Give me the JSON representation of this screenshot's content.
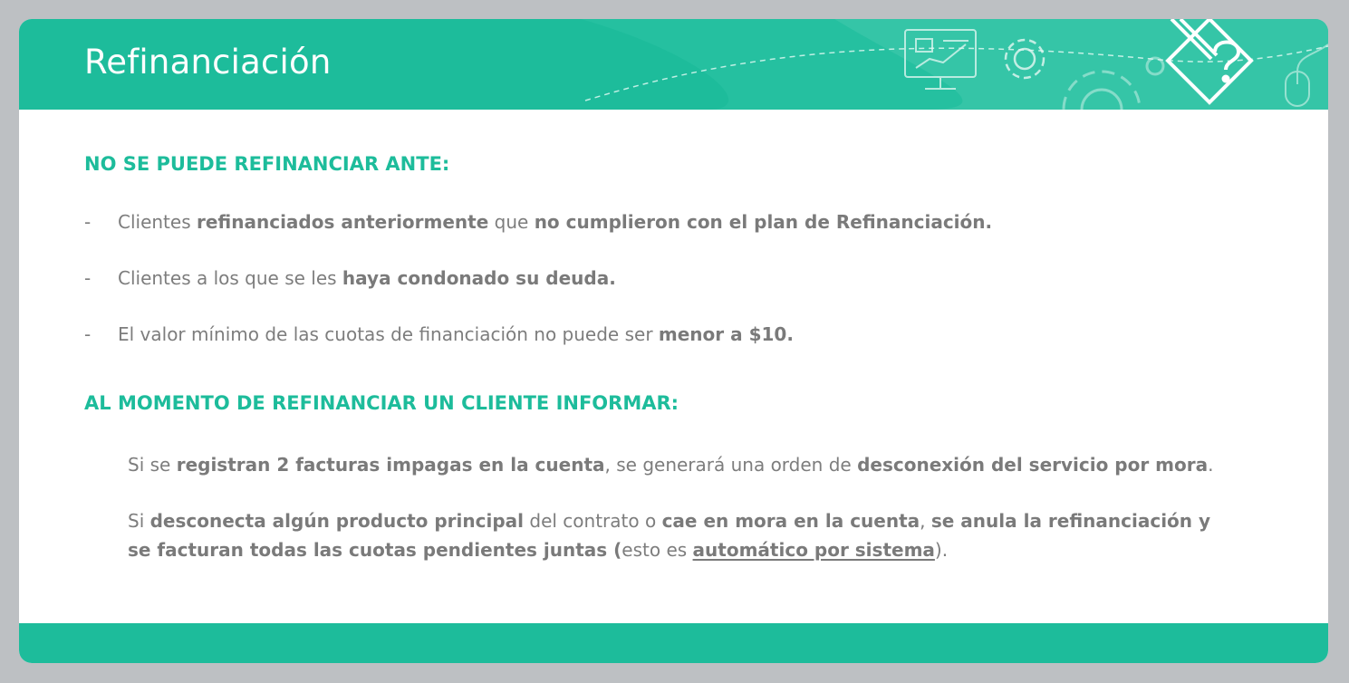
{
  "title": "Refinanciación",
  "colors": {
    "accent": "#1dbc9b",
    "body_text": "#7d7d7d",
    "background": "#bdc0c3"
  },
  "decorative_icons": [
    "monitor-chart-icon",
    "gear-icon",
    "large-gear-icon",
    "pencil-question-icon",
    "mouse-icon"
  ],
  "section1": {
    "heading": "NO SE PUEDE REFINANCIAR ANTE:",
    "bullet_marker": "-",
    "items": [
      {
        "t1": "Clientes ",
        "b1": "refinanciados anteriormente",
        "t2": " que ",
        "b2": "no cumplieron con el plan de Refinanciación."
      },
      {
        "t1": "Clientes a los que se les ",
        "b1": "haya condonado su deuda."
      },
      {
        "t1": "El valor mínimo de las cuotas de financiación no puede ser ",
        "b1": "menor a $10."
      }
    ]
  },
  "section2": {
    "heading": "AL MOMENTO DE REFINANCIAR UN CLIENTE INFORMAR:",
    "p1": {
      "t1": "Si se ",
      "b1": "registran 2 facturas impagas en la cuenta",
      "t2": ", se generará una orden de  ",
      "b2": "desconexión del servicio por mora",
      "t3": "."
    },
    "p2": {
      "t1": "Si ",
      "b1": "desconecta algún producto principal",
      "t2": " del contrato o ",
      "b2": "cae en mora en la cuenta",
      "t3": ", ",
      "b3": "se anula la refinanciación y se facturan todas las cuotas pendientes juntas (",
      "t4": "esto es ",
      "u1": "automático por sistema",
      "t5": ")."
    }
  }
}
